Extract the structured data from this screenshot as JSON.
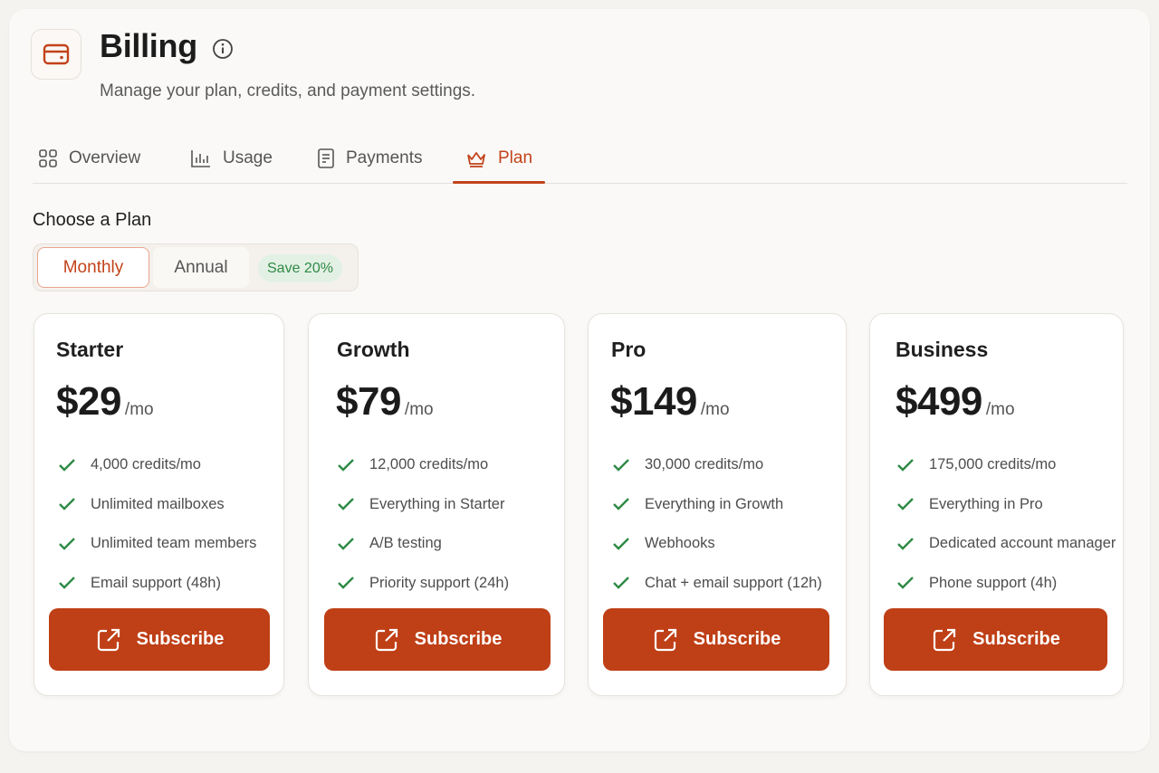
{
  "header": {
    "icon": "credit-card-icon",
    "title": "Billing",
    "info_icon": "info-icon",
    "subtitle": "Manage your plan, credits, and payment settings."
  },
  "tabs": [
    {
      "label": "Overview",
      "icon": "grid-icon",
      "active": false
    },
    {
      "label": "Usage",
      "icon": "bar-chart-icon",
      "active": false
    },
    {
      "label": "Payments",
      "icon": "receipt-icon",
      "active": false
    },
    {
      "label": "Plan",
      "icon": "crown-icon",
      "active": true
    }
  ],
  "plan_section": {
    "heading": "Choose a Plan",
    "billing_toggle": {
      "monthly": "Monthly",
      "annual": "Annual",
      "selected": "Monthly",
      "badge": "Save 20%"
    }
  },
  "plans": [
    {
      "name": "Starter",
      "price": "$29",
      "unit": "/mo",
      "features": [
        "4,000 credits/mo",
        "Unlimited mailboxes",
        "Unlimited team members",
        "Email support (48h)"
      ],
      "cta": "Subscribe"
    },
    {
      "name": "Growth",
      "price": "$79",
      "unit": "/mo",
      "features": [
        "12,000 credits/mo",
        "Everything in Starter",
        "A/B testing",
        "Priority support (24h)"
      ],
      "cta": "Subscribe"
    },
    {
      "name": "Pro",
      "price": "$149",
      "unit": "/mo",
      "features": [
        "30,000 credits/mo",
        "Everything in Growth",
        "Webhooks",
        "Chat + email support (12h)"
      ],
      "cta": "Subscribe"
    },
    {
      "name": "Business",
      "price": "$499",
      "unit": "/mo",
      "features": [
        "175,000 credits/mo",
        "Everything in Pro",
        "Dedicated account manager",
        "Phone support (4h)"
      ],
      "cta": "Subscribe"
    }
  ],
  "colors": {
    "accent": "#c2431a",
    "button": "#bf3f16",
    "check": "#2f8a45",
    "badge_bg": "#e3f1e5"
  }
}
